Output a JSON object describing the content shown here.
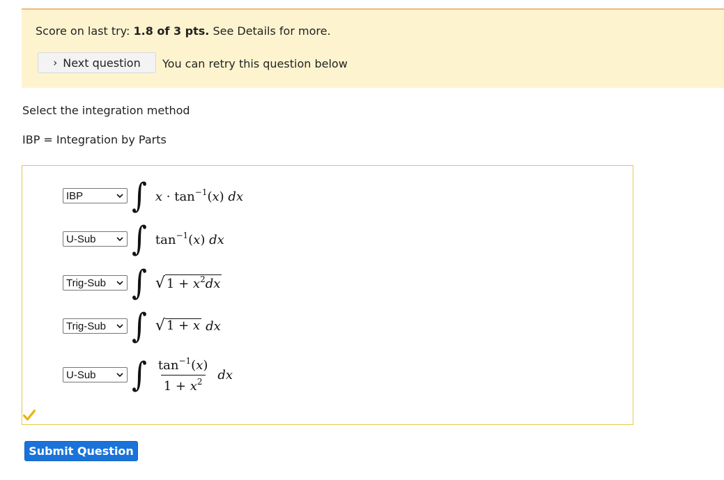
{
  "banner": {
    "score_prefix": "Score on last try:",
    "score_value": "1.8 of 3 pts.",
    "score_suffix": "See Details for more.",
    "next_button_label": "Next question",
    "retry_text": "You can retry this question below"
  },
  "question": {
    "prompt": "Select the integration method",
    "ibp_definition": "IBP = Integration by Parts"
  },
  "rows": [
    {
      "selected": "IBP"
    },
    {
      "selected": "U-Sub"
    },
    {
      "selected": "Trig-Sub"
    },
    {
      "selected": "Trig-Sub"
    },
    {
      "selected": "U-Sub"
    }
  ],
  "icons": {
    "correct": "checkmark-icon",
    "correct_color": "#f1c232"
  },
  "submit_label": "Submit Question",
  "colors": {
    "banner_bg": "#fdf4cf",
    "banner_border": "#f0b97a",
    "answer_border": "#e6c74a",
    "submit_bg": "#1a73d9"
  }
}
